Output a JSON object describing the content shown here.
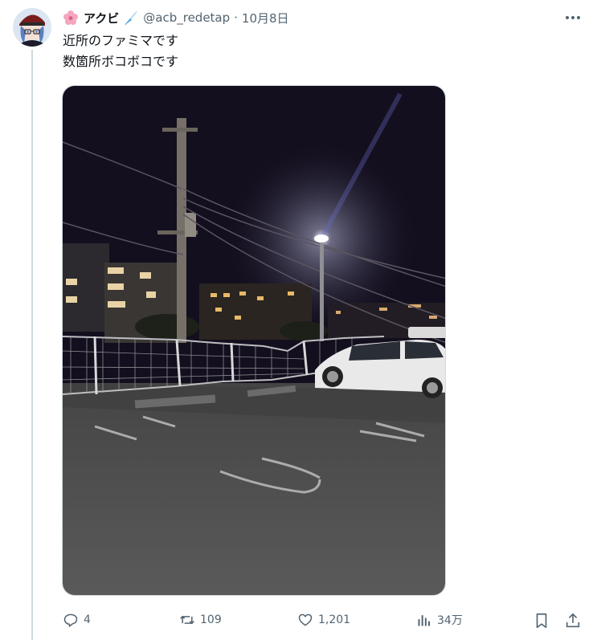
{
  "tweet": {
    "display_name": "アクビ",
    "handle": "@acb_redetap",
    "separator": "·",
    "date": "10月8日",
    "text_lines": [
      "近所のファミマです",
      "数箇所ボコボコです"
    ]
  },
  "actions": {
    "replies": "4",
    "retweets": "109",
    "likes": "1,201",
    "views": "34万"
  },
  "icons": {
    "more": "more-icon",
    "reply": "reply-icon",
    "retweet": "retweet-icon",
    "like": "like-icon",
    "views": "views-icon",
    "bookmark": "bookmark-icon",
    "share": "share-icon"
  },
  "colors": {
    "text_primary": "#0f1419",
    "text_secondary": "#536471",
    "thread_line": "#cfd9de"
  }
}
